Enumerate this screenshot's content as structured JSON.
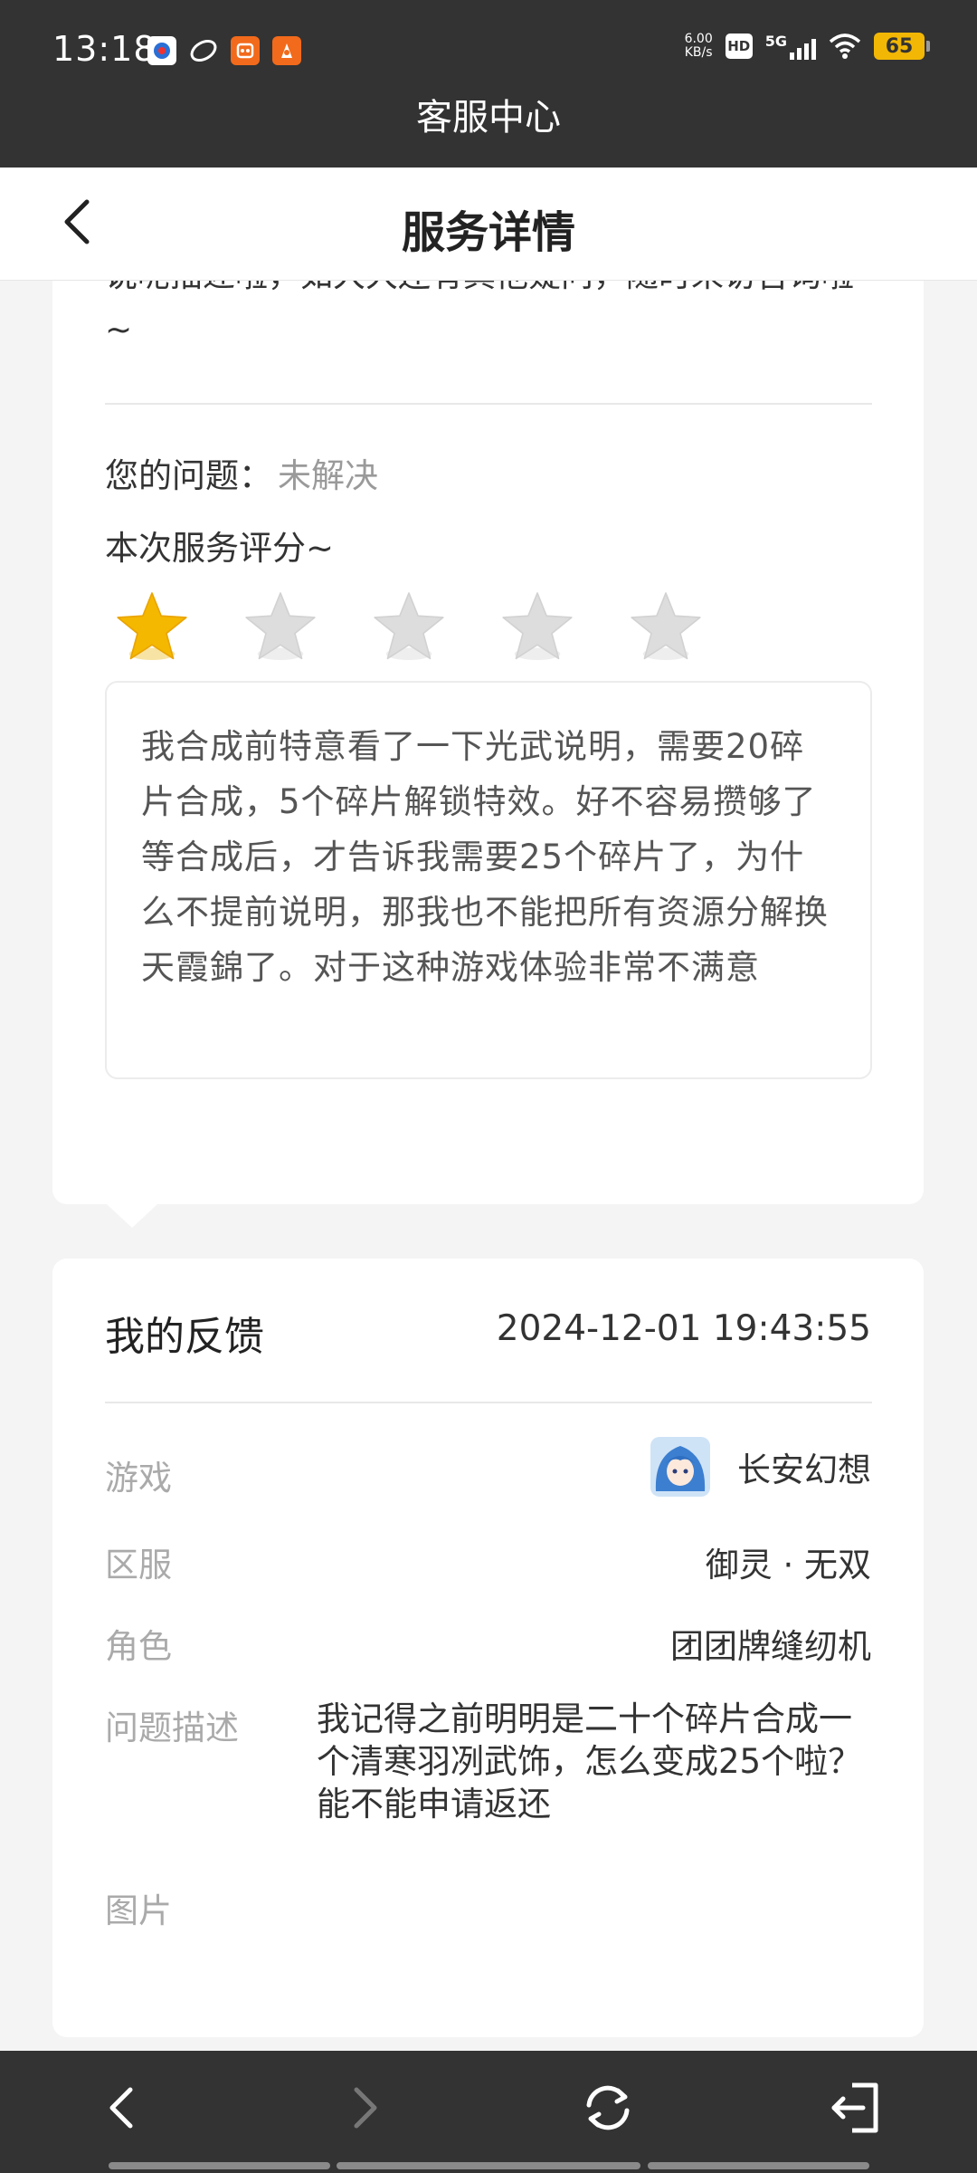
{
  "status_bar": {
    "time": "13:18",
    "net_speed_value": "6.00",
    "net_speed_unit": "KB/s",
    "hd": "HD",
    "signal": "5G",
    "battery": "65"
  },
  "header": {
    "title": "客服中心"
  },
  "navbar": {
    "title": "服务详情"
  },
  "service": {
    "reply_tail": "说呢描述啦，如大大还有其他疑问，随时来访咨询啦~",
    "question_label": "您的问题：",
    "question_status": "未解决",
    "rating_label": "本次服务评分~",
    "rating": 1,
    "rating_max": 5,
    "comment": "我合成前特意看了一下光武说明，需要20碎片合成，5个碎片解锁特效。好不容易攒够了等合成后，才告诉我需要25个碎片了，为什么不提前说明，那我也不能把所有资源分解换天霞錦了。对于这种游戏体验非常不满意"
  },
  "feedback": {
    "title": "我的反馈",
    "time": "2024-12-01 19:43:55",
    "rows": {
      "game_label": "游戏",
      "game_value": "长安幻想",
      "server_label": "区服",
      "server_value": "御灵 · 无双",
      "role_label": "角色",
      "role_value": "团团牌缝纫机",
      "desc_label": "问题描述",
      "desc_value": "我记得之前明明是二十个碎片合成一个清寒羽冽武饰，怎么变成25个啦？能不能申请返还",
      "image_label": "图片"
    }
  },
  "colors": {
    "dark_bar": "#333333",
    "star_active": "#f5b800",
    "star_inactive": "#dddddd",
    "battery": "#f2b705"
  },
  "icons": {
    "back": "chevron-left-icon",
    "browser_back": "arrow-left-icon",
    "browser_forward": "arrow-right-icon",
    "refresh": "refresh-icon",
    "exit": "exit-icon"
  }
}
